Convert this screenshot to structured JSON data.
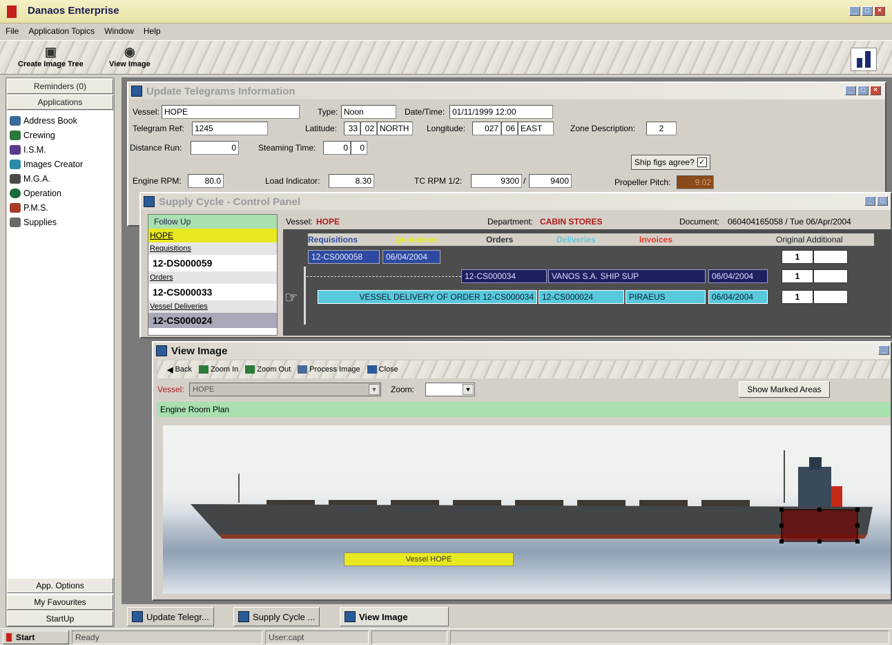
{
  "app": {
    "title": "Danaos Enterprise"
  },
  "menu": [
    "File",
    "Application Topics",
    "Window",
    "Help"
  ],
  "toolbar": {
    "create_image_tree": "Create Image Tree",
    "view_image": "View Image"
  },
  "sidebar": {
    "reminders": "Reminders (0)",
    "applications": "Applications",
    "items": [
      {
        "label": "Address Book",
        "icon": "address-book-icon",
        "color": "#3a6a9a"
      },
      {
        "label": "Crewing",
        "icon": "crewing-icon",
        "color": "#2a7a3a"
      },
      {
        "label": "I.S.M.",
        "icon": "ism-icon",
        "color": "#5a3a8a"
      },
      {
        "label": "Images Creator",
        "icon": "images-creator-icon",
        "color": "#2a8aa8"
      },
      {
        "label": "M.G.A.",
        "icon": "mga-icon",
        "color": "#4a4a4a"
      },
      {
        "label": "Operation",
        "icon": "operation-icon",
        "color": "#1a6a3a"
      },
      {
        "label": "P.M.S.",
        "icon": "pms-icon",
        "color": "#a83a2a"
      },
      {
        "label": "Supplies",
        "icon": "supplies-icon",
        "color": "#6a6a6a"
      }
    ],
    "app_options": "App. Options",
    "my_favourites": "My Favourites",
    "startup": "StartUp"
  },
  "telegrams": {
    "title": "Update Telegrams Information",
    "vessel_label": "Vessel:",
    "vessel": "HOPE",
    "type_label": "Type:",
    "type": "Noon",
    "datetime_label": "Date/Time:",
    "datetime": "01/11/1999 12:00",
    "telegram_ref_label": "Telegram Ref:",
    "telegram_ref": "1245",
    "latitude_label": "Latitude:",
    "lat_deg": "33",
    "lat_min": "02",
    "lat_dir": "NORTH",
    "longitude_label": "Longitude:",
    "lon_deg": "027",
    "lon_min": "06",
    "lon_dir": "EAST",
    "zone_label": "Zone Description:",
    "zone": "2",
    "distance_label": "Distance Run:",
    "distance": "0",
    "steaming_label": "Steaming Time:",
    "steaming_h": "0",
    "steaming_m": "0",
    "ship_figs_label": "Ship figs agree?",
    "rpm_label": "Engine RPM:",
    "rpm": "80.0",
    "load_label": "Load Indicator:",
    "load": "8.30",
    "tc_label": "TC RPM 1/2:",
    "tc1": "9300",
    "tc2": "9400",
    "pitch_label": "Propeller Pitch:",
    "pitch": "9.02"
  },
  "supply": {
    "title": "Supply Cycle - Control Panel",
    "follow_up": "Follow Up",
    "follow_vessel": "HOPE",
    "requisitions_label": "Requisitions",
    "requisition": "12-DS000059",
    "orders_label": "Orders",
    "order": "12-CS000033",
    "deliveries_label": "Vessel Deliveries",
    "delivery": "12-CS000024",
    "vessel_label": "Vessel:",
    "vessel": "HOPE",
    "department_label": "Department:",
    "department": "CABIN STORES",
    "document_label": "Document:",
    "document": "060404165058 / Tue 06/Apr/2004",
    "col_requisitions": "Requisitions",
    "col_quotations": "Quotations",
    "col_orders": "Orders",
    "col_deliveries": "Deliveries",
    "col_invoices": "Invoices",
    "col_original": "Original Additional",
    "row1_req": "12-CS000058",
    "row1_date": "06/04/2004",
    "row1_count": "1",
    "row2_order": "12-CS000034",
    "row2_supplier": "VANOS S.A. SHIP SUP",
    "row2_date": "06/04/2004",
    "row2_count": "1",
    "row3_desc": "VESSEL DELIVERY OF ORDER 12-CS000034",
    "row3_ref": "12-CS000024",
    "row3_port": "PIRAEUS",
    "row3_date": "06/04/2004",
    "row3_count": "1",
    "colors": {
      "quotations": "#e8e820",
      "deliveries": "#5ac8e0",
      "invoices": "#e83a2a"
    }
  },
  "viewimage": {
    "title": "View Image",
    "back": "Back",
    "zoom_in": "Zoom In",
    "zoom_out": "Zoom Out",
    "process": "Process Image",
    "close": "Close",
    "vessel_label": "Vessel:",
    "vessel": "HOPE",
    "zoom_label": "Zoom:",
    "show_marked": "Show Marked Areas",
    "image_caption": "Engine Room Plan",
    "marker_label": "Vessel HOPE"
  },
  "tabs": [
    "Update Telegr...",
    "Supply Cycle ...",
    "View Image"
  ],
  "status": {
    "start": "Start",
    "ready": "Ready",
    "user": "User:capt"
  }
}
